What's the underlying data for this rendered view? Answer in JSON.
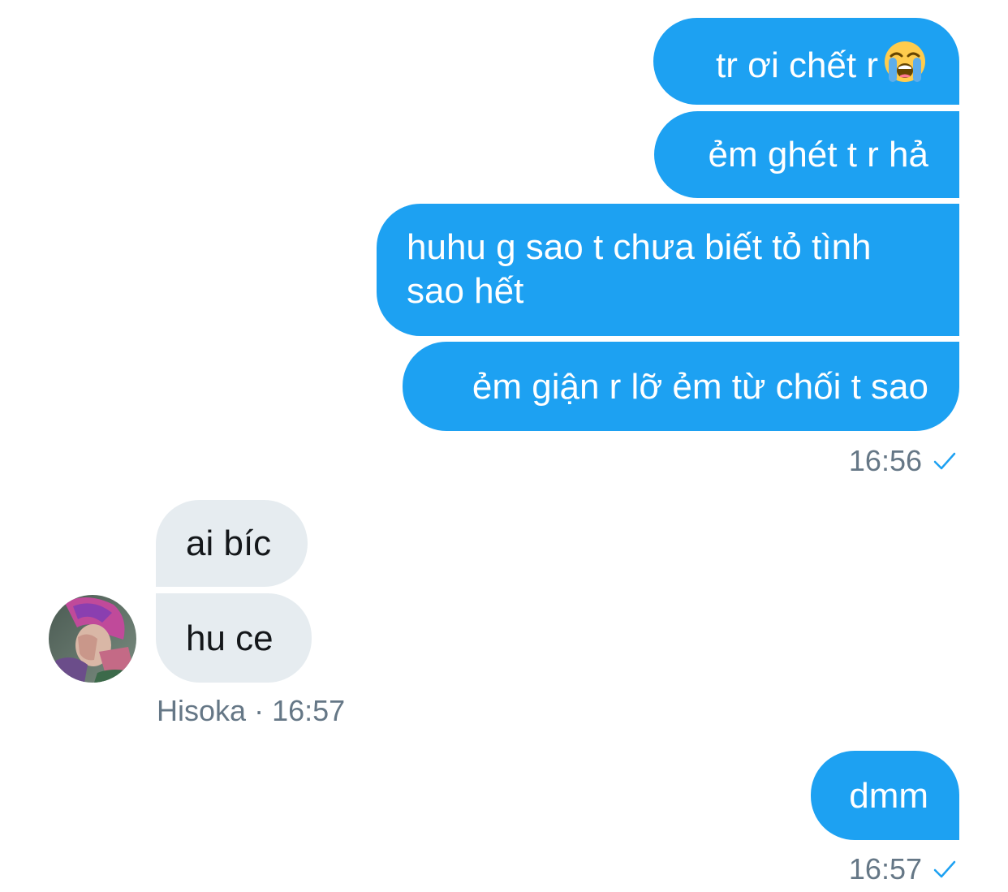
{
  "conversation": {
    "sent_group_1": [
      {
        "text": "tr ơi chết r",
        "emoji": "loudly-crying-face-icon"
      },
      {
        "text": "ẻm ghét t r hả"
      },
      {
        "text": "huhu g sao t chưa biết tỏ tình sao hết"
      },
      {
        "text": "ẻm giận r lỡ ẻm từ chối t sao"
      }
    ],
    "sent_group_1_time": "16:56",
    "received_group": [
      {
        "text": "ai bíc"
      },
      {
        "text": "hu ce"
      }
    ],
    "received_sender": "Hisoka",
    "received_separator": "·",
    "received_time": "16:57",
    "sent_group_2": [
      {
        "text": "dmm"
      }
    ],
    "sent_group_2_time": "16:57"
  },
  "colors": {
    "sent_bubble": "#1da1f2",
    "received_bubble": "#e6ecf0",
    "meta_text": "#657786",
    "check_mark": "#1da1f2"
  }
}
